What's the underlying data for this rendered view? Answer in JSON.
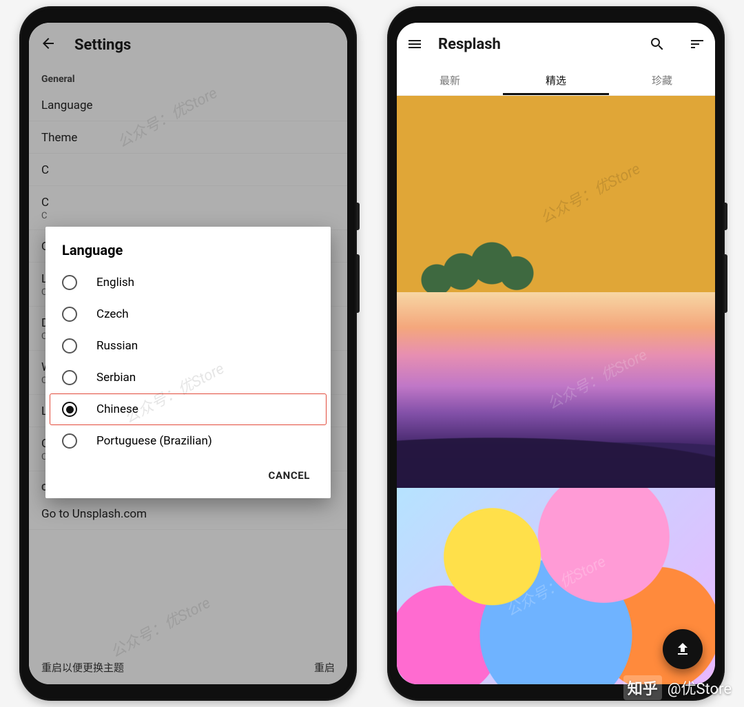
{
  "watermark": {
    "zhihu_brand": "知乎",
    "author": "@优Store",
    "diagonal_text": "公众号：优Store"
  },
  "left_phone": {
    "appbar_title": "Settings",
    "sections": {
      "general_label": "General",
      "other_label": "Other"
    },
    "rows": {
      "language": "Language",
      "theme": "Theme",
      "c_row_1": "C",
      "c_row_2": "C",
      "c_row_2_sub": "C",
      "q_row": "Q",
      "l_row": "L",
      "l_row_sub": "C",
      "d_row": "D",
      "d_row_sub": "C",
      "w_row": "W",
      "w_row_sub": "C",
      "layout_row": "L",
      "choose_layout": "Choose Layout",
      "choose_layout_sub": "Choose how images are displayed",
      "go_unsplash": "Go to Unsplash.com"
    },
    "toast": {
      "message": "重启以便更换主题",
      "action": "重启"
    },
    "dialog": {
      "title": "Language",
      "options": [
        "English",
        "Czech",
        "Russian",
        "Serbian",
        "Chinese",
        "Portuguese (Brazilian)"
      ],
      "selected_index": 4,
      "cancel_label": "CANCEL"
    }
  },
  "right_phone": {
    "appbar_title": "Resplash",
    "tabs": [
      "最新",
      "精选",
      "珍藏"
    ],
    "active_tab_index": 1
  }
}
